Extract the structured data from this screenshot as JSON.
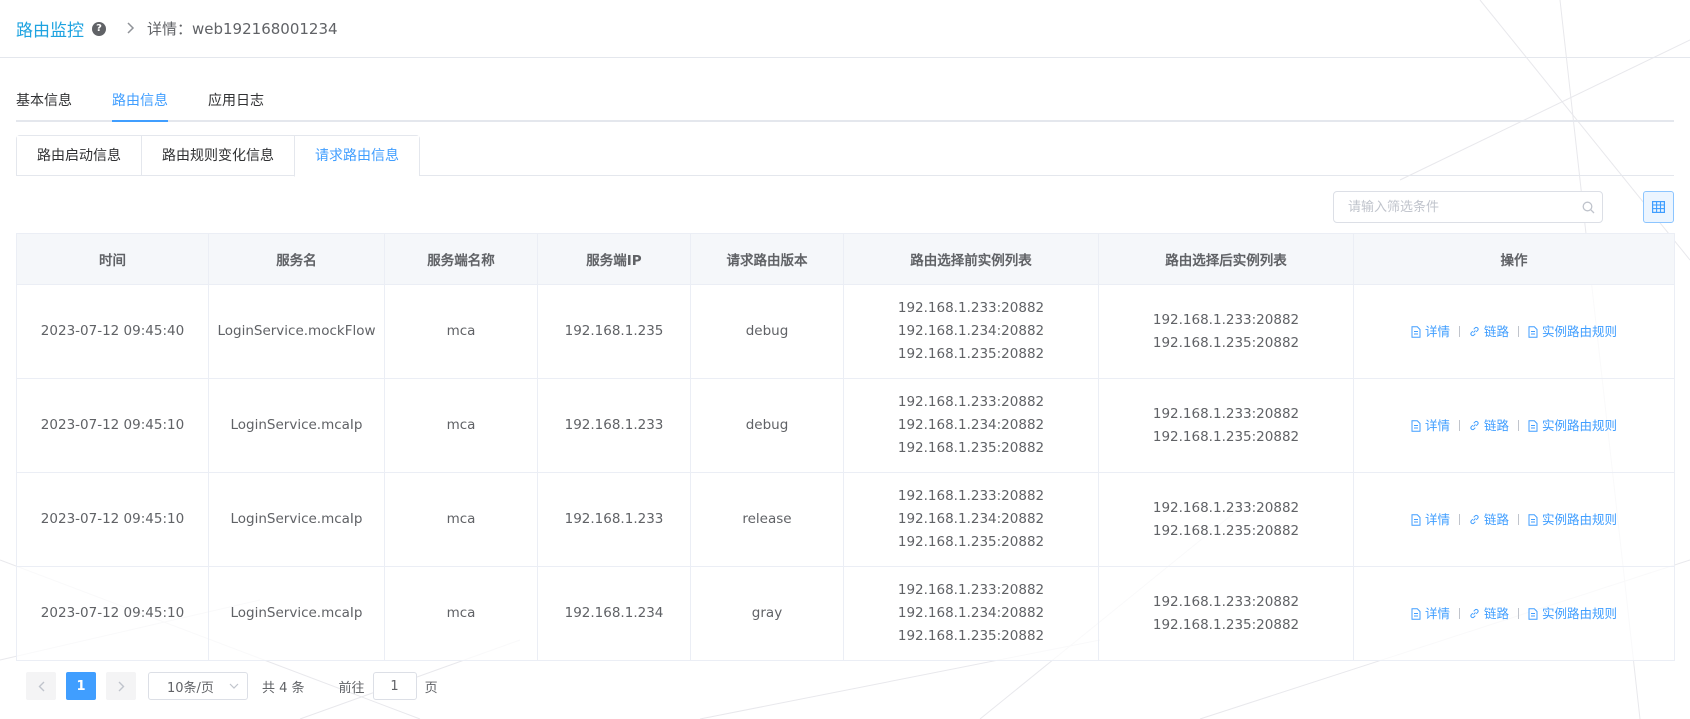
{
  "header": {
    "breadcrumb_root": "路由监控",
    "breadcrumb_detail": "详情：web192168001234"
  },
  "main_tabs": [
    {
      "label": "基本信息",
      "active": false
    },
    {
      "label": "路由信息",
      "active": true
    },
    {
      "label": "应用日志",
      "active": false
    }
  ],
  "sub_tabs": [
    {
      "label": "路由启动信息",
      "active": false
    },
    {
      "label": "路由规则变化信息",
      "active": false
    },
    {
      "label": "请求路由信息",
      "active": true
    }
  ],
  "filter": {
    "placeholder": "请输入筛选条件",
    "value": ""
  },
  "table": {
    "columns": [
      "时间",
      "服务名",
      "服务端名称",
      "服务端IP",
      "请求路由版本",
      "路由选择前实例列表",
      "路由选择后实例列表",
      "操作"
    ],
    "rows": [
      {
        "time": "2023-07-12 09:45:40",
        "service": "LoginService.mockFlow",
        "server_name": "mca",
        "server_ip": "192.168.1.235",
        "version": "debug",
        "before": [
          "192.168.1.233:20882",
          "192.168.1.234:20882",
          "192.168.1.235:20882"
        ],
        "after": [
          "192.168.1.233:20882",
          "192.168.1.235:20882"
        ],
        "actions": [
          "详情",
          "链路",
          "实例路由规则"
        ]
      },
      {
        "time": "2023-07-12 09:45:10",
        "service": "LoginService.mcaIp",
        "server_name": "mca",
        "server_ip": "192.168.1.233",
        "version": "debug",
        "before": [
          "192.168.1.233:20882",
          "192.168.1.234:20882",
          "192.168.1.235:20882"
        ],
        "after": [
          "192.168.1.233:20882",
          "192.168.1.235:20882"
        ],
        "actions": [
          "详情",
          "链路",
          "实例路由规则"
        ]
      },
      {
        "time": "2023-07-12 09:45:10",
        "service": "LoginService.mcaIp",
        "server_name": "mca",
        "server_ip": "192.168.1.233",
        "version": "release",
        "before": [
          "192.168.1.233:20882",
          "192.168.1.234:20882",
          "192.168.1.235:20882"
        ],
        "after": [
          "192.168.1.233:20882",
          "192.168.1.235:20882"
        ],
        "actions": [
          "详情",
          "链路",
          "实例路由规则"
        ]
      },
      {
        "time": "2023-07-12 09:45:10",
        "service": "LoginService.mcaIp",
        "server_name": "mca",
        "server_ip": "192.168.1.234",
        "version": "gray",
        "before": [
          "192.168.1.233:20882",
          "192.168.1.234:20882",
          "192.168.1.235:20882"
        ],
        "after": [
          "192.168.1.233:20882",
          "192.168.1.235:20882"
        ],
        "actions": [
          "详情",
          "链路",
          "实例路由规则"
        ]
      }
    ]
  },
  "pagination": {
    "current_page": "1",
    "page_size_label": "10条/页",
    "total_label": "共 4 条",
    "goto_label": "前往",
    "goto_value": "1",
    "page_unit": "页"
  },
  "colors": {
    "accent": "#409eff",
    "breadcrumb": "#1ea3e0",
    "header_bg": "#f5f7fa",
    "border": "#ebeef5"
  },
  "icons": [
    "help-icon",
    "chevron-right-icon",
    "search-icon",
    "grid-view-icon",
    "document-icon",
    "link-icon",
    "chevron-left-icon",
    "chevron-down-icon"
  ]
}
